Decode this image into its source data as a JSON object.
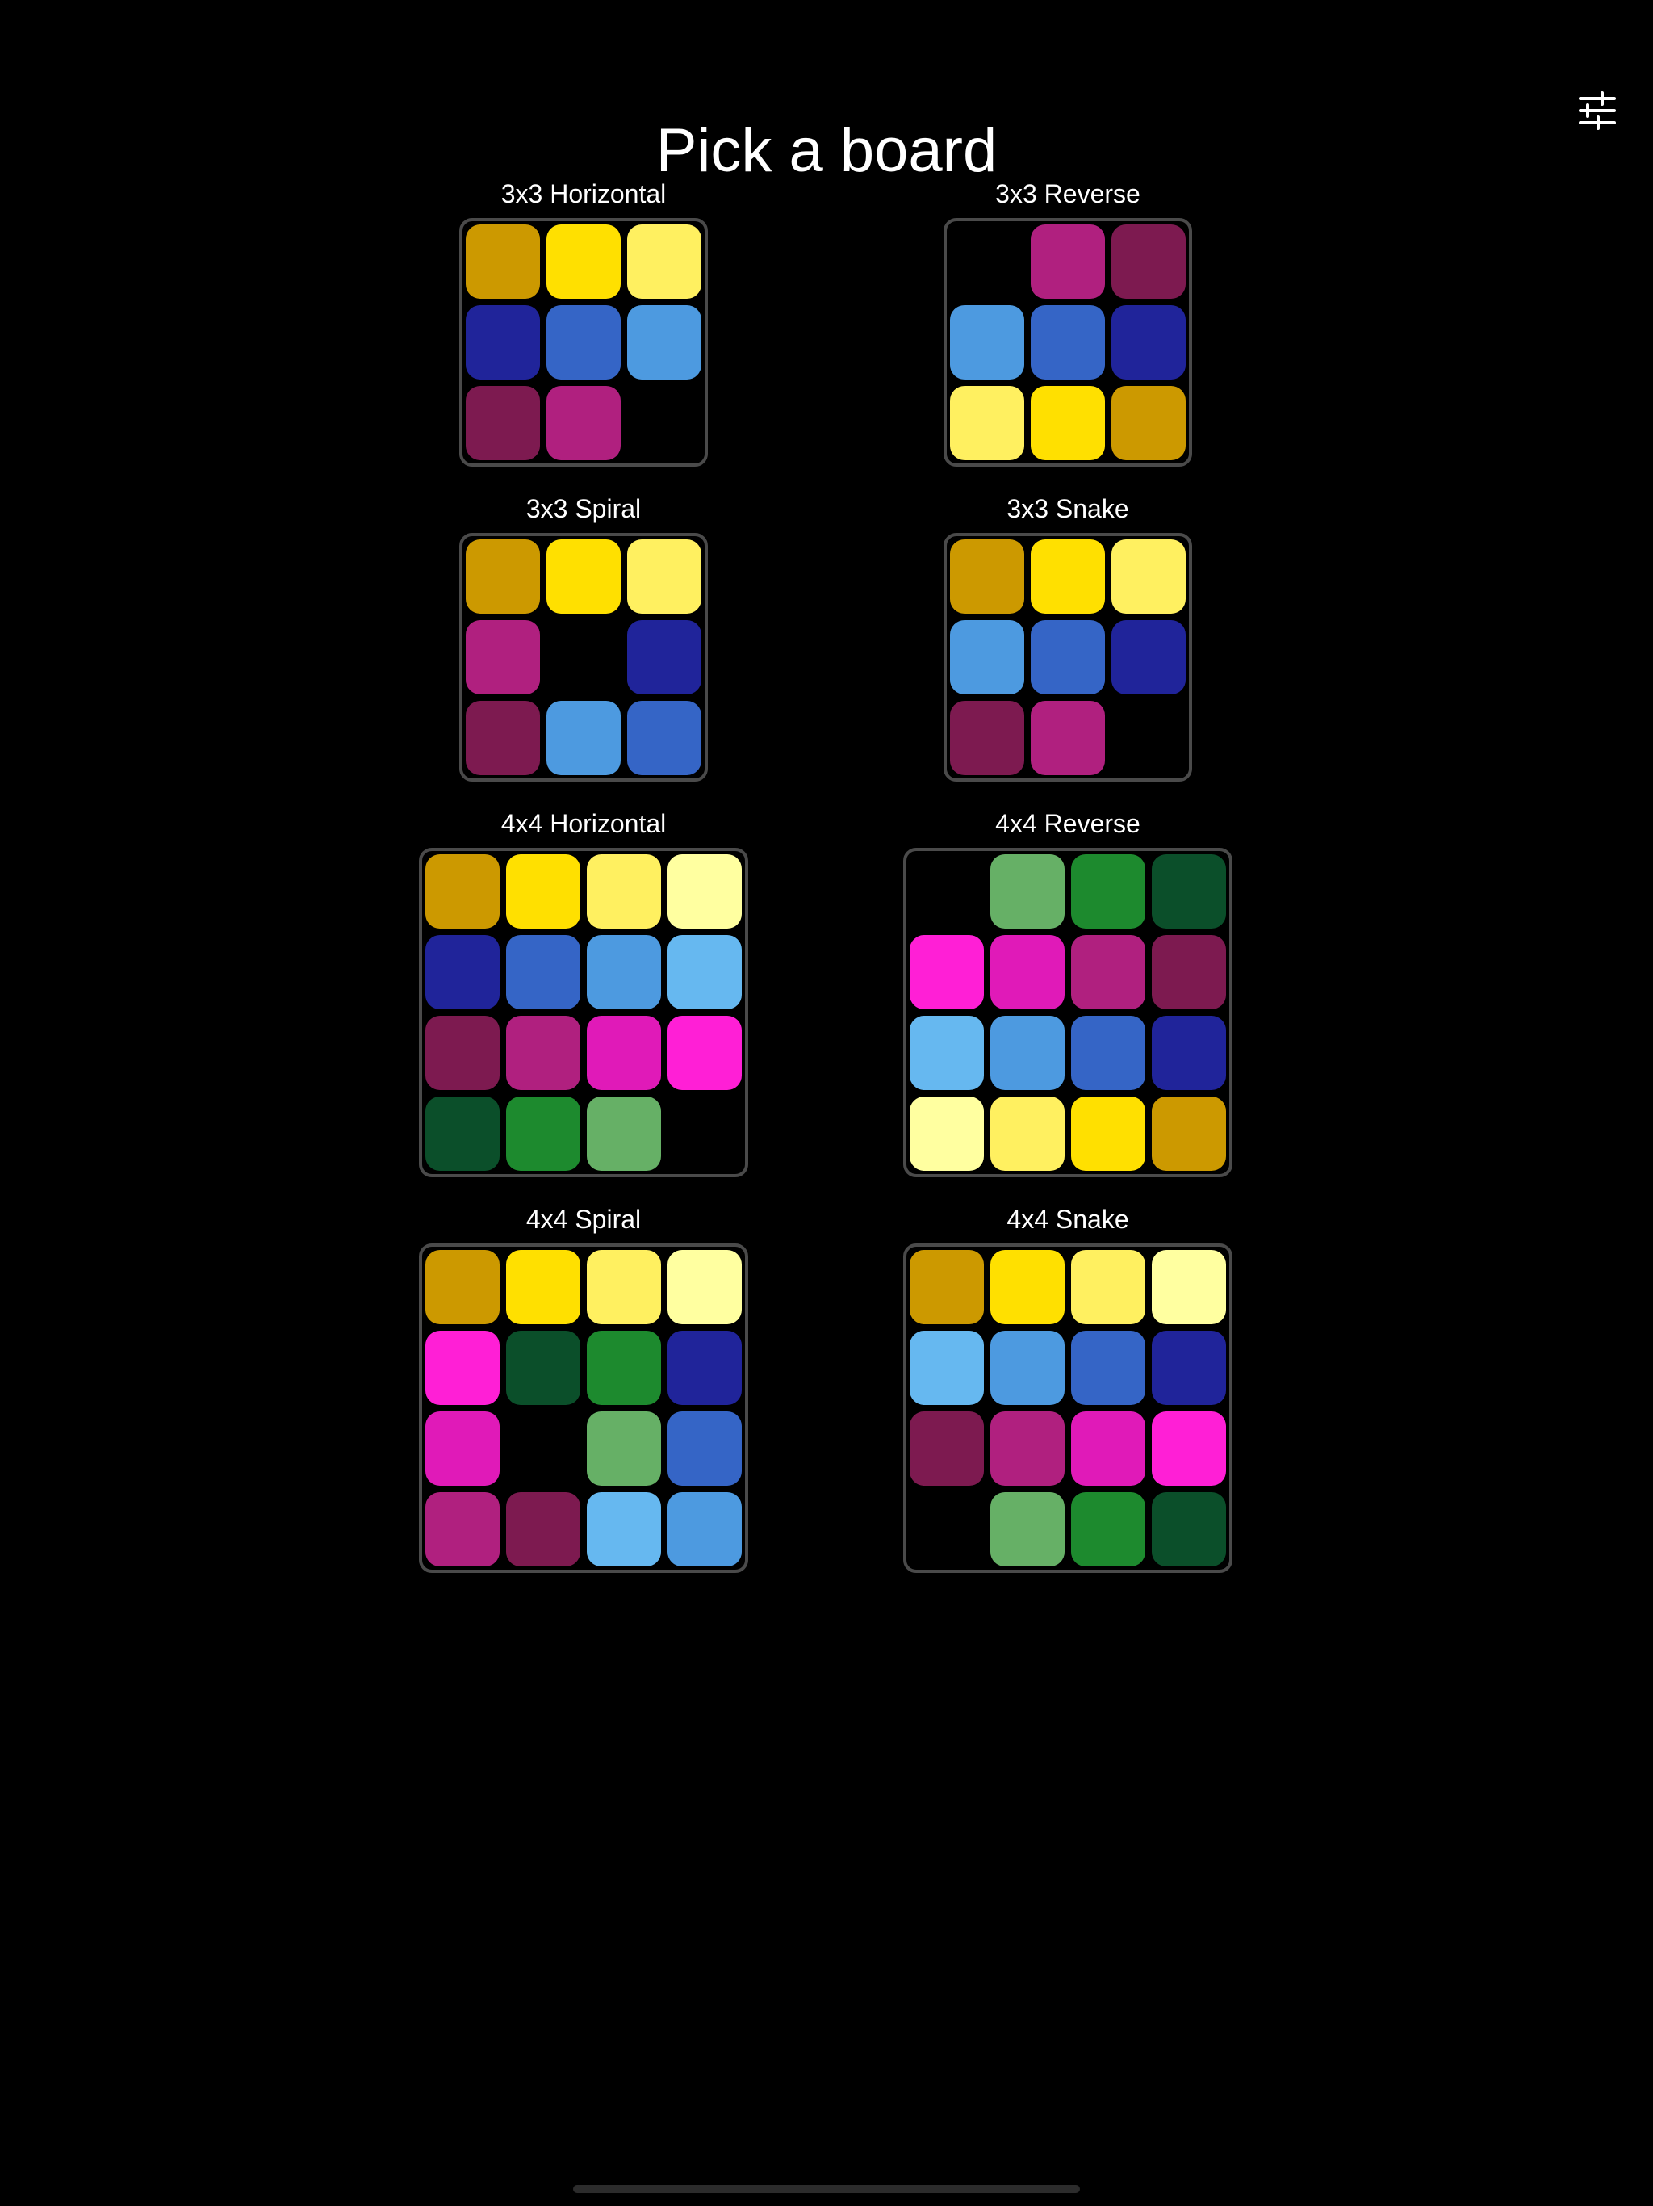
{
  "header": {
    "title": "Pick a board",
    "settings_icon": "sliders-icon"
  },
  "colors": {
    "background": "#000000",
    "frame_border": "#4a4a4a",
    "palette": {
      "Y1": "#cc9900",
      "Y2": "#ffe000",
      "Y3": "#fff060",
      "Y4": "#ffffa0",
      "B1": "#20249a",
      "B2": "#3565c6",
      "B3": "#4d9ae0",
      "B4": "#66b8f0",
      "M1": "#7d1a50",
      "M2": "#b0207f",
      "M3": "#e01ab8",
      "M4": "#ff1fd6",
      "G1": "#0b4f2a",
      "G2": "#1d8a2e",
      "G3": "#66b066"
    }
  },
  "boards": [
    {
      "label": "3x3 Horizontal",
      "size": 3,
      "grid": [
        [
          "Y1",
          "Y2",
          "Y3"
        ],
        [
          "B1",
          "B2",
          "B3"
        ],
        [
          "M1",
          "M2",
          null
        ]
      ]
    },
    {
      "label": "3x3 Reverse",
      "size": 3,
      "grid": [
        [
          null,
          "M2",
          "M1"
        ],
        [
          "B3",
          "B2",
          "B1"
        ],
        [
          "Y3",
          "Y2",
          "Y1"
        ]
      ]
    },
    {
      "label": "3x3 Spiral",
      "size": 3,
      "grid": [
        [
          "Y1",
          "Y2",
          "Y3"
        ],
        [
          "M2",
          null,
          "B1"
        ],
        [
          "M1",
          "B3",
          "B2"
        ]
      ]
    },
    {
      "label": "3x3 Snake",
      "size": 3,
      "grid": [
        [
          "Y1",
          "Y2",
          "Y3"
        ],
        [
          "B3",
          "B2",
          "B1"
        ],
        [
          "M1",
          "M2",
          null
        ]
      ]
    },
    {
      "label": "4x4 Horizontal",
      "size": 4,
      "grid": [
        [
          "Y1",
          "Y2",
          "Y3",
          "Y4"
        ],
        [
          "B1",
          "B2",
          "B3",
          "B4"
        ],
        [
          "M1",
          "M2",
          "M3",
          "M4"
        ],
        [
          "G1",
          "G2",
          "G3",
          null
        ]
      ]
    },
    {
      "label": "4x4 Reverse",
      "size": 4,
      "grid": [
        [
          null,
          "G3",
          "G2",
          "G1"
        ],
        [
          "M4",
          "M3",
          "M2",
          "M1"
        ],
        [
          "B4",
          "B3",
          "B2",
          "B1"
        ],
        [
          "Y4",
          "Y3",
          "Y2",
          "Y1"
        ]
      ]
    },
    {
      "label": "4x4 Spiral",
      "size": 4,
      "grid": [
        [
          "Y1",
          "Y2",
          "Y3",
          "Y4"
        ],
        [
          "M4",
          "G1",
          "G2",
          "B1"
        ],
        [
          "M3",
          null,
          "G3",
          "B2"
        ],
        [
          "M2",
          "M1",
          "B4",
          "B3"
        ]
      ]
    },
    {
      "label": "4x4 Snake",
      "size": 4,
      "grid": [
        [
          "Y1",
          "Y2",
          "Y3",
          "Y4"
        ],
        [
          "B4",
          "B3",
          "B2",
          "B1"
        ],
        [
          "M1",
          "M2",
          "M3",
          "M4"
        ],
        [
          null,
          "G3",
          "G2",
          "G1"
        ]
      ]
    }
  ]
}
